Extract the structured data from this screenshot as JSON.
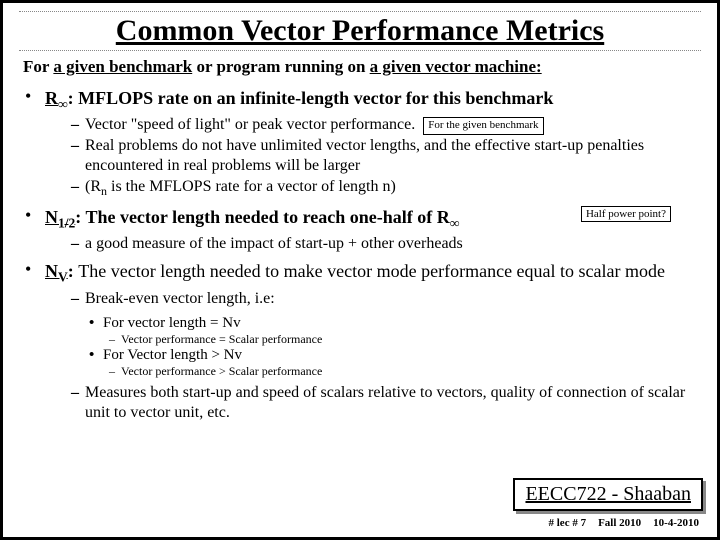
{
  "title": "Common Vector Performance Metrics",
  "intro_pre": "For ",
  "intro_u1": "a given benchmark",
  "intro_mid": " or program running on ",
  "intro_u2": "a given vector machine:",
  "rinf_term": "R",
  "rinf_sub": "∞",
  "rinf_colon": ": ",
  "rinf_desc": "MFLOPS rate on an infinite-length vector for this benchmark",
  "rinf_d1": "Vector \"speed of light\" or peak vector performance.",
  "rinf_d1_box": "For the given benchmark",
  "rinf_d2": "Real problems do not have unlimited vector lengths, and the effective start-up penalties encountered in real problems will be larger",
  "rinf_d3_a": "(R",
  "rinf_d3_sub": "n",
  "rinf_d3_b": " is the MFLOPS rate for a vector of length n)",
  "n12_term": "N",
  "n12_sub": "1/2",
  "n12_colon": ": ",
  "n12_desc_a": "The vector length needed to reach one-half of R",
  "n12_desc_sub": "∞",
  "n12_box": "Half power point?",
  "n12_d1": "a good measure of the impact of start-up + other overheads",
  "nv_term": "N",
  "nv_sub": "V",
  "nv_colon": ": ",
  "nv_desc": "The vector length needed to make vector mode performance equal to scalar mode",
  "nv_d1": "Break-even vector length, i.e:",
  "nv_b1": "For vector length = Nv",
  "nv_b1_d": "Vector performance = Scalar performance",
  "nv_b2": "For Vector length > Nv",
  "nv_b2_d": "Vector performance > Scalar performance",
  "nv_d2": "Measures both start-up and speed of scalars relative to vectors, quality of connection of scalar unit to vector unit, etc.",
  "footer_course": "EECC722 - Shaaban",
  "footer_lec": "#  lec # 7",
  "footer_term": "Fall 2010",
  "footer_date": "10-4-2010"
}
